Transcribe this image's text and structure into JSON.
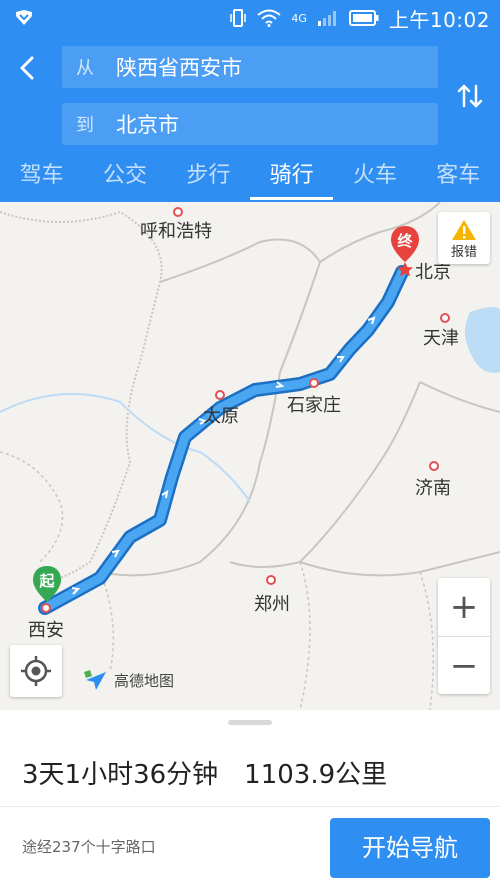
{
  "status_bar": {
    "network": "4G",
    "time": "上午10:02"
  },
  "header": {
    "from_prefix": "从",
    "from_value": "陕西省西安市",
    "to_prefix": "到",
    "to_value": "北京市"
  },
  "tabs": [
    {
      "label": "驾车",
      "active": false
    },
    {
      "label": "公交",
      "active": false
    },
    {
      "label": "步行",
      "active": false
    },
    {
      "label": "骑行",
      "active": true
    },
    {
      "label": "火车",
      "active": false
    },
    {
      "label": "客车",
      "active": false
    }
  ],
  "map": {
    "cities": {
      "hohhot": "呼和浩特",
      "beijing": "北京",
      "tianjin": "天津",
      "taiyuan": "太原",
      "shijiazhuang": "石家庄",
      "jinan": "济南",
      "zhengzhou": "郑州",
      "xian": "西安"
    },
    "start_marker": "起",
    "end_marker": "终",
    "report_label": "报错",
    "zoom_in": "+",
    "zoom_out": "−",
    "logo_text": "高德地图",
    "route_color": "#3a9be8"
  },
  "panel": {
    "duration": "3天1小时36分钟",
    "distance": "1103.9公里",
    "via": "途经237个十字路口",
    "start_nav": "开始导航"
  }
}
